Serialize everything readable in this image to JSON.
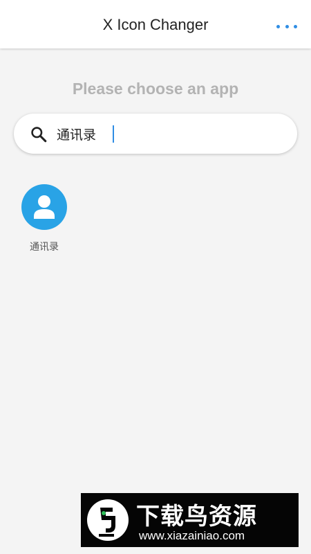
{
  "app_bar": {
    "title": "X Icon Changer",
    "menu_icon": "more-horizontal-icon"
  },
  "prompt": {
    "text": "Please choose an app"
  },
  "search": {
    "icon": "search-icon",
    "value": "通讯录",
    "placeholder": ""
  },
  "apps": [
    {
      "label": "通讯录",
      "icon": "contacts-person-icon",
      "icon_color": "#29a3e6"
    }
  ],
  "watermark": {
    "title": "下载鸟资源",
    "url": "www.xiazainiao.com"
  },
  "colors": {
    "accent": "#2f8de4",
    "background": "#f4f4f4",
    "app_bar": "#ffffff",
    "prompt_text": "#b3b3b3"
  }
}
